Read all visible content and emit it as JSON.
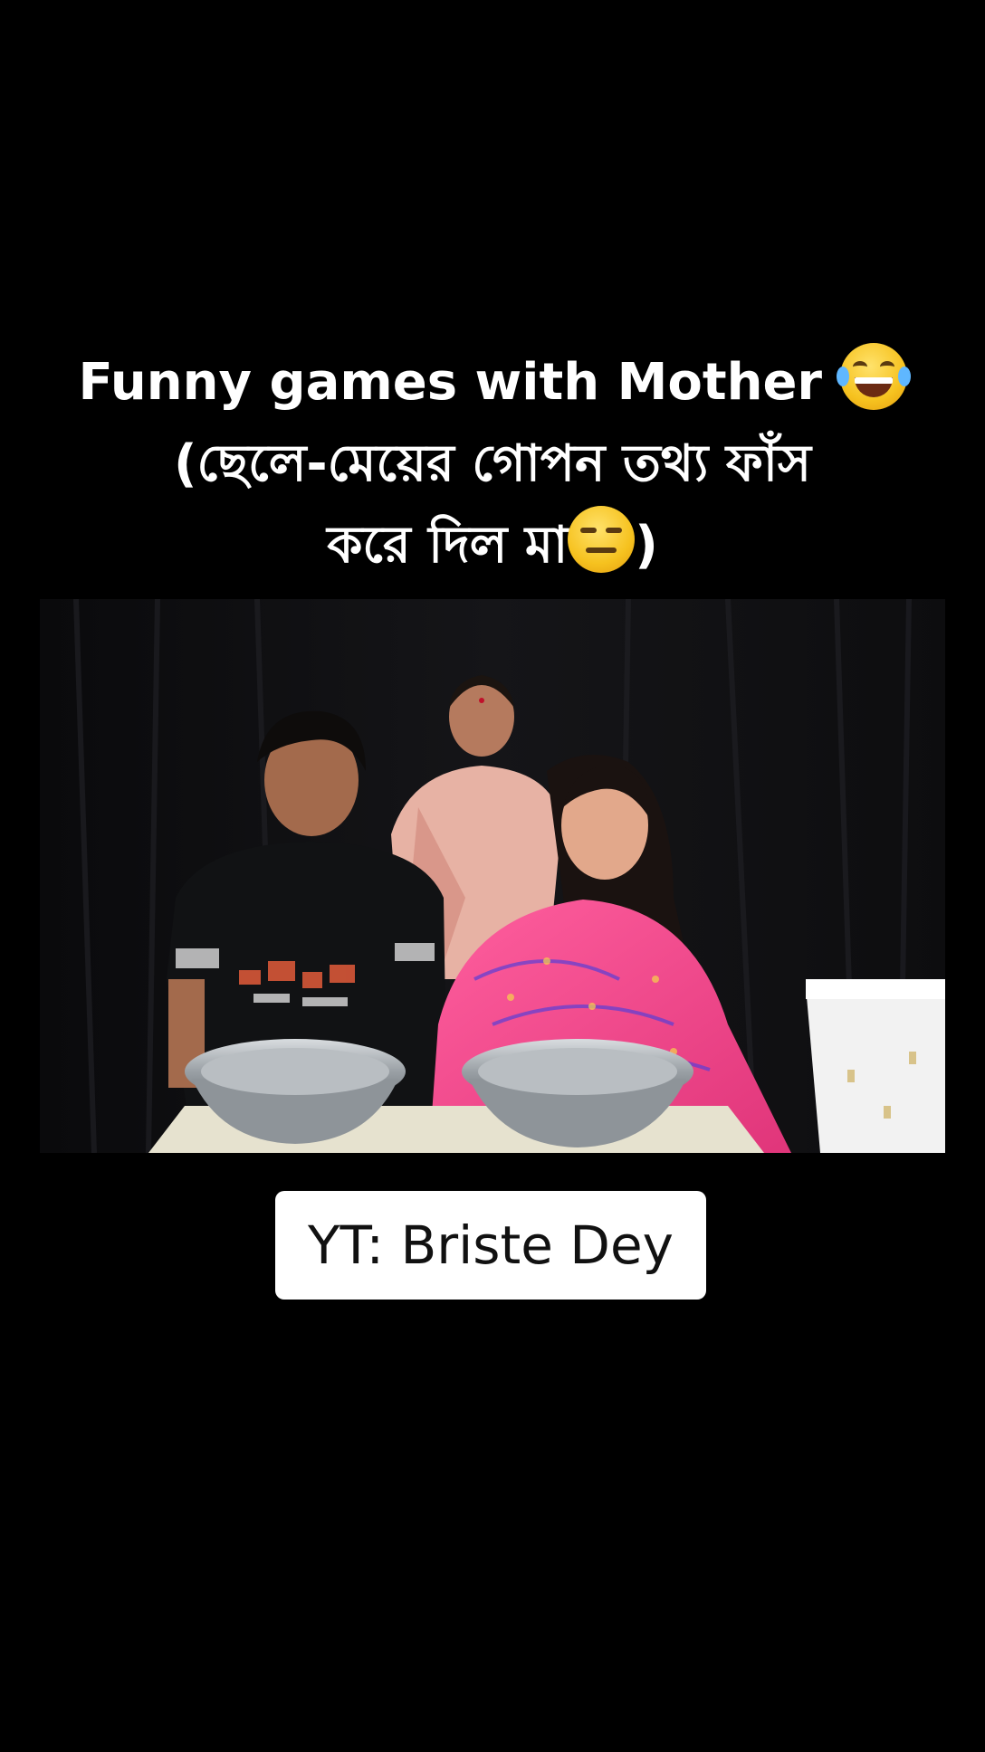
{
  "caption": {
    "line1_text": "Funny games with Mother ",
    "line1_emoji": "laughing-with-tears-emoji",
    "line2_text": "(ছেলে-মেয়ের গোপন তথ্য ফাঁস",
    "line3_text": "করে দিল মা",
    "line3_emoji": "expressionless-face-emoji",
    "line3_end": ")"
  },
  "video": {
    "description_icon": "video-frame"
  },
  "badge": {
    "label": "YT: Briste Dey"
  },
  "colors": {
    "background": "#000000",
    "caption_text": "#ffffff",
    "badge_bg": "#ffffff",
    "badge_text": "#111111"
  }
}
